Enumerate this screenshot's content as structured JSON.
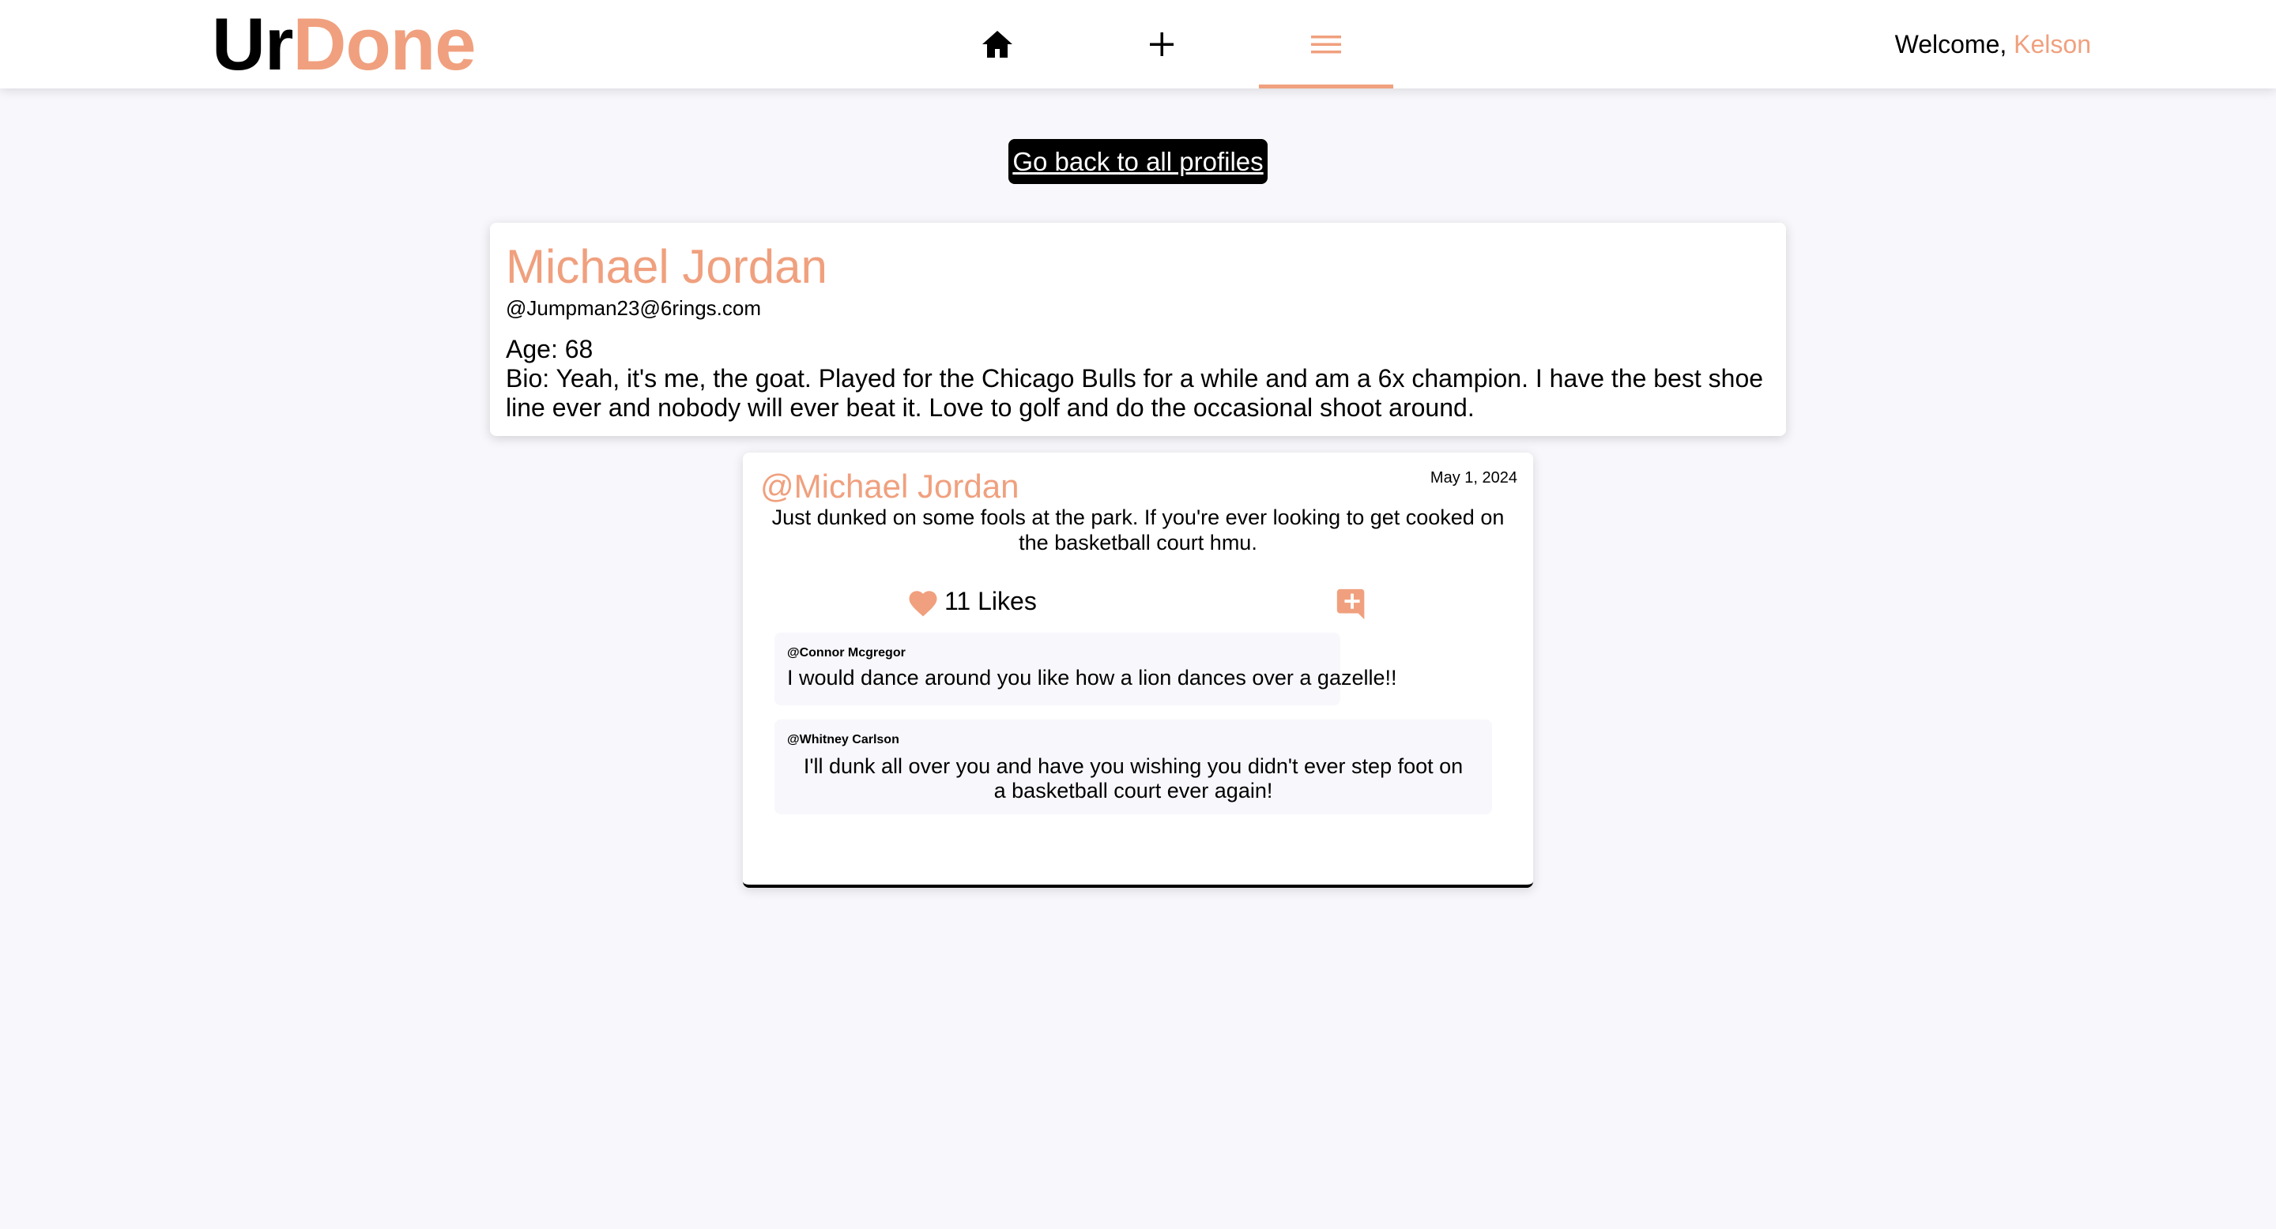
{
  "brand": {
    "name_part1": "Ur",
    "name_part2": "Done",
    "accent_color": "#f0a07e"
  },
  "nav": {
    "items": [
      {
        "icon": "home-icon",
        "active": false
      },
      {
        "icon": "plus-icon",
        "active": false
      },
      {
        "icon": "menu-icon",
        "active": true
      }
    ],
    "welcome_prefix": "Welcome, ",
    "user_name": "Kelson"
  },
  "back_button": {
    "label": "Go back to all profiles"
  },
  "profile": {
    "name": "Michael Jordan",
    "email": "@Jumpman23@6rings.com",
    "age": "Age: 68",
    "bio": "Bio: Yeah, it's me, the goat. Played for the Chicago Bulls for a while and am a 6x champion. I have the best shoe line ever and nobody will ever beat it. Love to golf and do the occasional shoot around."
  },
  "post": {
    "author": "@Michael Jordan",
    "date": "May 1, 2024",
    "text": "Just dunked on some fools at the park. If you're ever looking to get cooked on the basketball court hmu.",
    "likes": "11 Likes",
    "like_icon": "heart-icon",
    "comment_icon": "add-comment-icon",
    "comments": [
      {
        "author": "@Connor Mcgregor",
        "text": "I would dance around you like how a lion dances over a gazelle!!"
      },
      {
        "author": "@Whitney Carlson",
        "text": "I'll dunk all over you and have you wishing you didn't ever step foot on a basketball court ever again!"
      }
    ]
  }
}
